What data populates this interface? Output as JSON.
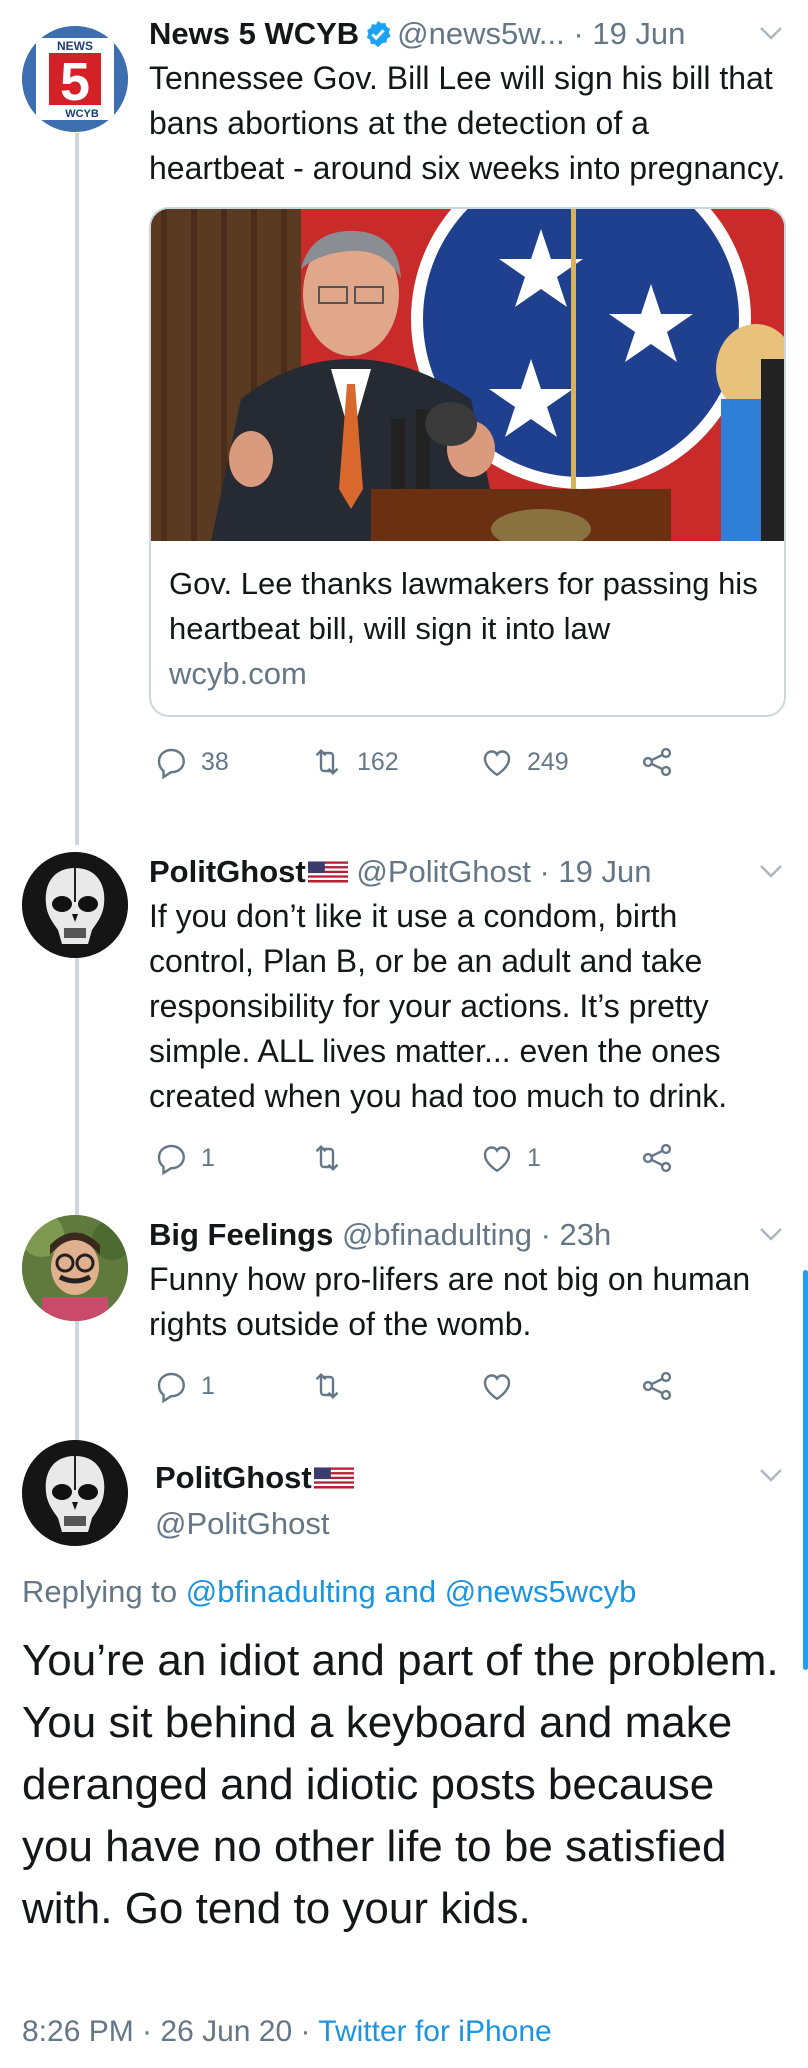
{
  "tweets": [
    {
      "name": "News 5 WCYB",
      "handle": "@news5w...",
      "time": "· 19 Jun",
      "text": "Tennessee Gov. Bill Lee will sign his bill that bans abortions at the detection of a heartbeat - around six weeks into pregnancy.",
      "card": {
        "title": "Gov. Lee thanks lawmakers for passing his heartbeat bill, will sign it into law",
        "domain": "wcyb.com"
      },
      "replies": "38",
      "retweets": "162",
      "likes": "249"
    },
    {
      "name": "PolitGhost",
      "handle": "@PolitGhost",
      "time": "· 19 Jun",
      "text": "If you don’t like it use a condom, birth control, Plan B, or be an adult and take responsibility for your actions. It’s pretty simple. ALL lives matter... even the ones created when you had too much to drink.",
      "replies": "1",
      "retweets": "",
      "likes": "1"
    },
    {
      "name": "Big Feelings",
      "handle": "@bfinadulting",
      "time": "· 23h",
      "text": "Funny how pro-lifers are not big on human rights outside of the womb.",
      "replies": "1",
      "retweets": "",
      "likes": ""
    }
  ],
  "focused": {
    "name": "PolitGhost",
    "handle": "@PolitGhost",
    "replying_prefix": "Replying to ",
    "replying_user1": "@bfinadulting",
    "replying_and": " and ",
    "replying_user2": "@news5wcyb",
    "text": "You’re an idiot and part of the problem. You sit behind a keyboard and make deranged and idiotic posts because you have no other life to be satisfied with. Go tend to your kids.",
    "timestamp": "8:26 PM · 26 Jun 20 · ",
    "source": "Twitter for iPhone"
  },
  "logo": {
    "top": "NEWS",
    "number": "5",
    "bottom": "WCYB"
  },
  "colors": {
    "link": "#1b95e0",
    "secondary": "#657786",
    "verified": "#1da1f2"
  },
  "icons": [
    "reply-icon",
    "retweet-icon",
    "like-icon",
    "share-icon",
    "chevron-down-icon",
    "verified-badge-icon",
    "us-flag-icon"
  ]
}
